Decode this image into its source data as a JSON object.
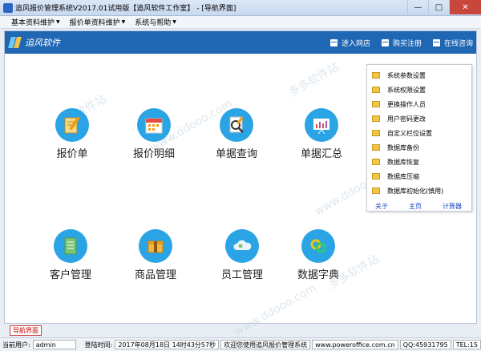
{
  "window": {
    "title": "追风报价管理系统V2017.01试用版【追风软件工作室】 - [导航界面]",
    "buttons": {
      "minimize": "—",
      "maximize": "□",
      "close": "✕"
    }
  },
  "menubar": {
    "items": [
      {
        "label": "基本资料维护"
      },
      {
        "label": "报价单资料维护"
      },
      {
        "label": "系统与帮助"
      }
    ]
  },
  "header": {
    "brand": "追风软件",
    "links": [
      {
        "label": "进入网店",
        "icon": "store-icon"
      },
      {
        "label": "购买注册",
        "icon": "cart-icon"
      },
      {
        "label": "在线咨询",
        "icon": "chat-icon"
      }
    ]
  },
  "tiles": [
    {
      "label": "报价单",
      "icon": "quote-edit-icon",
      "color": "#2aa4e4"
    },
    {
      "label": "报价明细",
      "icon": "calendar-icon",
      "color": "#2aa4e4"
    },
    {
      "label": "单据查询",
      "icon": "search-doc-icon",
      "color": "#2aa4e4"
    },
    {
      "label": "单据汇总",
      "icon": "chart-board-icon",
      "color": "#2aa4e4"
    },
    {
      "label": "客户管理",
      "icon": "notebook-icon",
      "color": "#2aa4e4"
    },
    {
      "label": "商品管理",
      "icon": "box-icon",
      "color": "#2aa4e4"
    },
    {
      "label": "员工管理",
      "icon": "cloud-icon",
      "color": "#2aa4e4"
    },
    {
      "label": "数据字典",
      "icon": "rings-icon",
      "color": "#2aa4e4"
    }
  ],
  "side_panel": {
    "items": [
      {
        "label": "系统参数设置"
      },
      {
        "label": "系统权限设置"
      },
      {
        "label": "更换操作人员"
      },
      {
        "label": "用户密码更改"
      },
      {
        "label": "自定义栏位设置"
      },
      {
        "label": "数据库备份"
      },
      {
        "label": "数据库恢复"
      },
      {
        "label": "数据库压缩"
      },
      {
        "label": "数据库初始化(慎用)"
      }
    ],
    "links": [
      {
        "label": "关于"
      },
      {
        "label": "主页"
      },
      {
        "label": "计算器"
      }
    ]
  },
  "nav_tab": {
    "label": "导航界面"
  },
  "status": {
    "user_label": "当前用户:",
    "user_value": "admin",
    "login_label": "登陆时间:",
    "login_value": "2017年08月18日 14时43分57秒",
    "message": "欢迎您使用追风报价管理系统",
    "website": "www.poweroffice.com.cn",
    "qq": "QQ:45931795",
    "tel": "TEL:15"
  },
  "watermarks": [
    "多多软件站",
    "www.ddooo.com",
    "多多软件站",
    "www.ddooo.com",
    "多多软件站",
    "www.ddooo.com"
  ]
}
